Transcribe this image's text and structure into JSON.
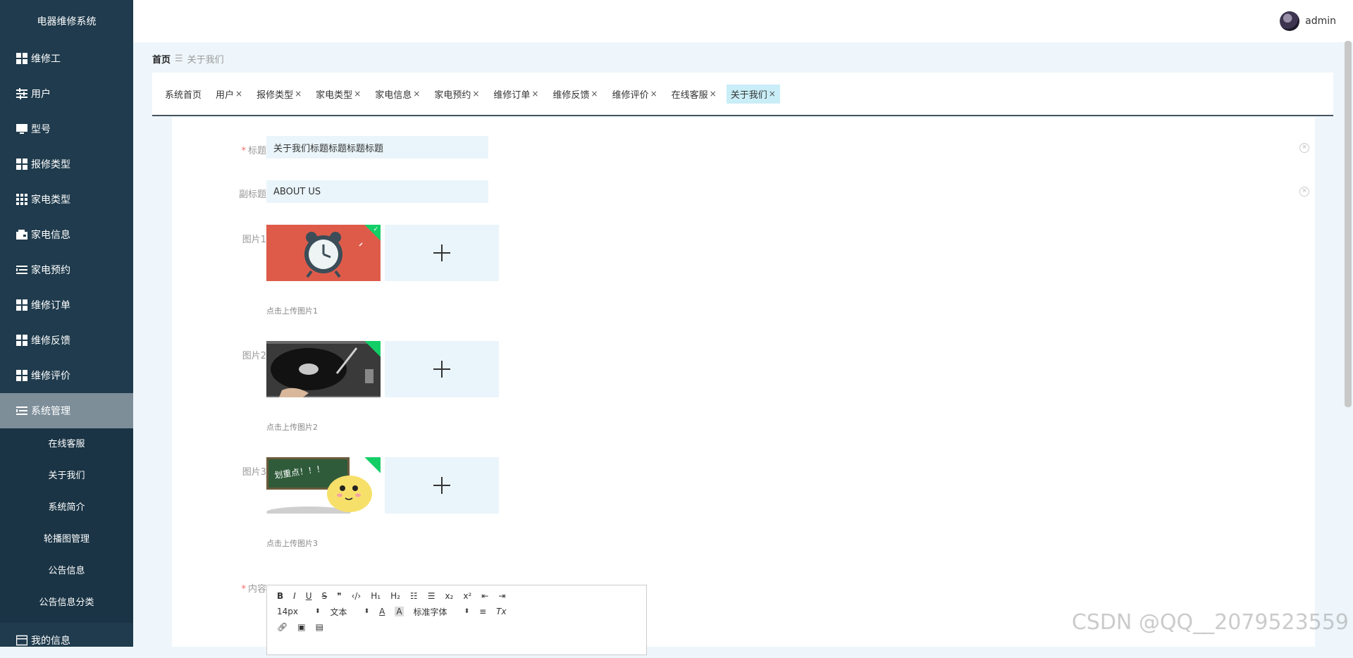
{
  "app": {
    "title": "电器维修系统"
  },
  "sidebar": {
    "items": [
      {
        "label": "维修工",
        "icon": "grid-icon"
      },
      {
        "label": "用户",
        "icon": "sliders-icon"
      },
      {
        "label": "型号",
        "icon": "monitor-icon"
      },
      {
        "label": "报修类型",
        "icon": "grid-icon"
      },
      {
        "label": "家电类型",
        "icon": "apps-icon"
      },
      {
        "label": "家电信息",
        "icon": "wallet-icon"
      },
      {
        "label": "家电预约",
        "icon": "list-icon"
      },
      {
        "label": "维修订单",
        "icon": "grid-icon"
      },
      {
        "label": "维修反馈",
        "icon": "grid-icon"
      },
      {
        "label": "维修评价",
        "icon": "grid-icon"
      }
    ],
    "system": {
      "label": "系统管理",
      "icon": "list-icon"
    },
    "subitems": [
      "在线客服",
      "关于我们",
      "系统简介",
      "轮播图管理",
      "公告信息",
      "公告信息分类"
    ],
    "my_info": {
      "label": "我的信息",
      "icon": "card-icon"
    }
  },
  "topbar": {
    "username": "admin"
  },
  "breadcrumb": {
    "home": "首页",
    "current": "关于我们"
  },
  "tabs": [
    {
      "label": "系统首页",
      "closable": false
    },
    {
      "label": "用户",
      "closable": true
    },
    {
      "label": "报修类型",
      "closable": true
    },
    {
      "label": "家电类型",
      "closable": true
    },
    {
      "label": "家电信息",
      "closable": true
    },
    {
      "label": "家电预约",
      "closable": true
    },
    {
      "label": "维修订单",
      "closable": true
    },
    {
      "label": "维修反馈",
      "closable": true
    },
    {
      "label": "维修评价",
      "closable": true
    },
    {
      "label": "在线客服",
      "closable": true
    },
    {
      "label": "关于我们",
      "closable": true,
      "active": true
    }
  ],
  "close_glyph": "×",
  "form": {
    "title_label": "标题",
    "title_value": "关于我们标题标题标题标题",
    "subtitle_label": "副标题",
    "subtitle_value": "ABOUT US",
    "pic1_label": "图片1",
    "pic1_hint": "点击上传图片1",
    "pic2_label": "图片2",
    "pic2_hint": "点击上传图片2",
    "pic3_label": "图片3",
    "pic3_hint": "点击上传图片3",
    "content_label": "内容",
    "required_mark": "*"
  },
  "editor": {
    "font_size": "14px",
    "block_type": "文本",
    "font_family": "标准字体",
    "bold": "B",
    "italic": "I",
    "underline": "U",
    "strike": "S",
    "h1": "H₁",
    "h2": "H₂",
    "sub": "x₂",
    "sup": "x²",
    "clear_format": "Tx"
  },
  "watermark": "CSDN @QQ__2079523559",
  "colors": {
    "sidebar_bg": "#1f3b4d",
    "active_tab": "#c9eef7",
    "upload_bg": "#eaf5fb",
    "required": "#f56c6c"
  }
}
